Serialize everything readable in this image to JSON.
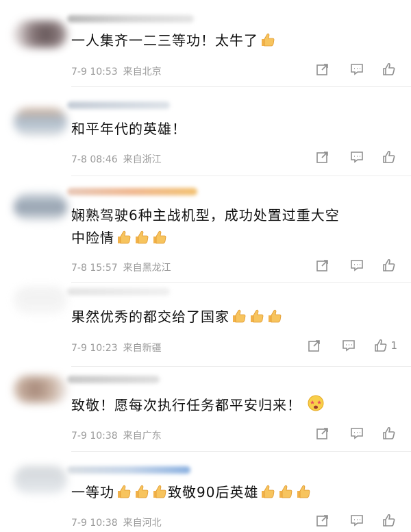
{
  "comments": [
    {
      "text": "一人集齐一二三等功！太牛了",
      "trailing_emojis": [
        "thumbs-up"
      ],
      "time": "7-9 10:53",
      "location": "来自北京",
      "likes": ""
    },
    {
      "text": "和平年代的英雄！",
      "trailing_emojis": [],
      "time": "7-8 08:46",
      "location": "来自浙江",
      "likes": ""
    },
    {
      "text_line1": "娴熟驾驶6种主战机型，成功处置过重大空",
      "text_line2": "中险情",
      "trailing_emojis": [
        "thumbs-up",
        "thumbs-up",
        "thumbs-up"
      ],
      "time": "7-8 15:57",
      "location": "来自黑龙江",
      "likes": ""
    },
    {
      "text": "果然优秀的都交给了国家",
      "trailing_emojis": [
        "thumbs-up",
        "thumbs-up",
        "thumbs-up"
      ],
      "time": "7-9 10:23",
      "location": "来自新疆",
      "likes": "1"
    },
    {
      "text": "致敬！愿每次执行任务都平安归来！",
      "trailing_emojis": [
        "star-eyes-face"
      ],
      "time": "7-9 10:38",
      "location": "来自广东",
      "likes": ""
    },
    {
      "text_part1": "一等功",
      "text_part2": "致敬90后英雄",
      "time": "7-9 10:38",
      "location": "来自河北",
      "likes": ""
    }
  ],
  "colors": {
    "text": "#111111",
    "meta": "#9a9a9a",
    "icon": "#8f8f8f",
    "divider": "#ececec"
  },
  "icons": {
    "forward": "forward-icon",
    "comment": "comment-icon",
    "like": "thumbs-up-icon"
  }
}
